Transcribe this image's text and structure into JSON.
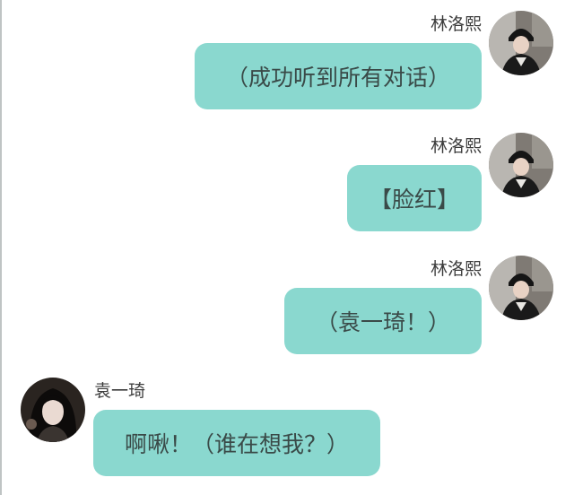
{
  "messages": [
    {
      "side": "right",
      "sender": "林洛熙",
      "text": "（成功听到所有对话）",
      "avatar_icon": "user-avatar-icon-1"
    },
    {
      "side": "right",
      "sender": "林洛熙",
      "text": "【脸红】",
      "avatar_icon": "user-avatar-icon-1"
    },
    {
      "side": "right",
      "sender": "林洛熙",
      "text": "（袁一琦！）",
      "avatar_icon": "user-avatar-icon-1"
    },
    {
      "side": "left",
      "sender": "袁一琦",
      "text": "啊啾！（谁在想我？）",
      "avatar_icon": "user-avatar-icon-2"
    }
  ],
  "colors": {
    "bubble": "#8ad8cf",
    "bubble_text": "#3a4a48",
    "name_text": "#3c3c3c",
    "background": "#ffffff"
  }
}
